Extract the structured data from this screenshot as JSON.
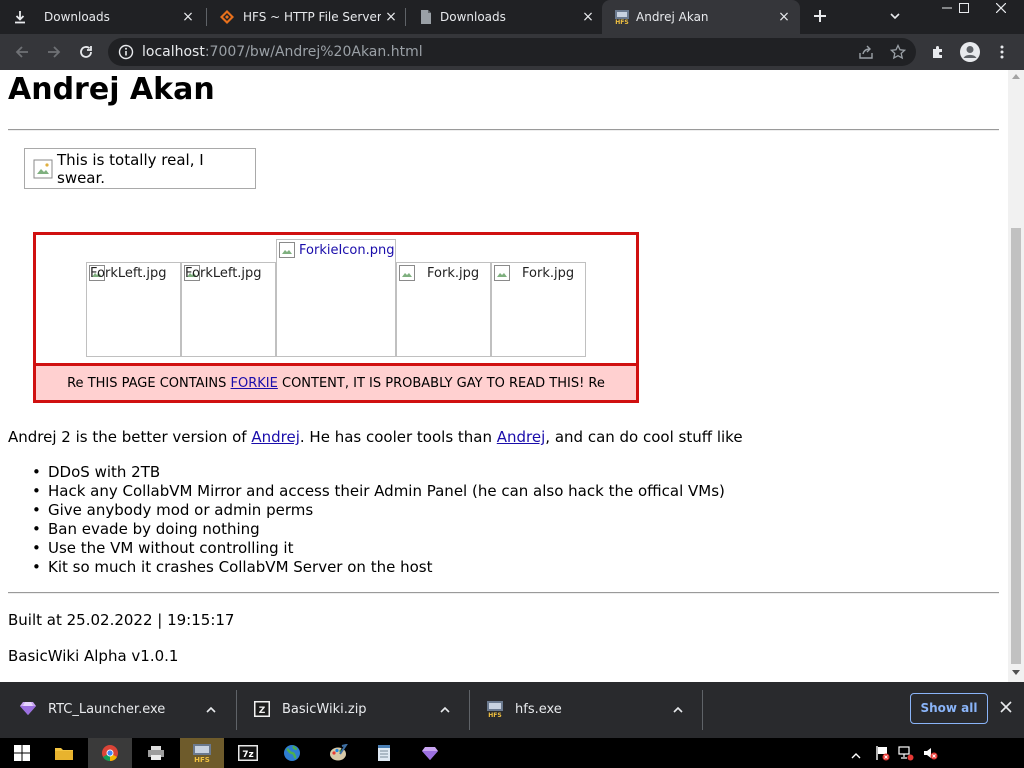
{
  "browser": {
    "tabs": [
      {
        "title": "Downloads",
        "icon": "download-icon",
        "active": false
      },
      {
        "title": "HFS ~ HTTP File Server d",
        "icon": "hfs-diamond-icon",
        "active": false
      },
      {
        "title": "Downloads",
        "icon": "page-icon",
        "active": false
      },
      {
        "title": "Andrej Akan",
        "icon": "hfs-logo-icon",
        "active": true
      }
    ],
    "new_tab_label": "+",
    "close_glyph": "×",
    "window_controls": {
      "minimize": "—",
      "maximize": "",
      "close": "✕"
    },
    "url_host": "localhost",
    "url_rest": ":7007/bw/Andrej%20Akan.html"
  },
  "page": {
    "title": "Andrej Akan",
    "caption": "This is totally real, I swear.",
    "forkie": {
      "images": [
        {
          "alt": "ForkLeft.jpg"
        },
        {
          "alt": "ForkLeft.jpg"
        },
        {
          "alt": "ForkieIcon.png",
          "link": true
        },
        {
          "alt": "Fork.jpg"
        },
        {
          "alt": "Fork.jpg"
        }
      ],
      "warning_before": "Re THIS PAGE CONTAINS ",
      "warning_link": "FORKIE",
      "warning_after": " CONTENT, IT IS PROBABLY GAY TO READ THIS! Re"
    },
    "intro": {
      "part1": "Andrej 2 is the better version of ",
      "link1": "Andrej",
      "part2": ". He has cooler tools than ",
      "link2": "Andrej",
      "part3": ", and can do cool stuff like"
    },
    "abilities": [
      "DDoS with 2TB",
      "Hack any CollabVM Mirror and access their Admin Panel (he can also hack the offical VMs)",
      "Give anybody mod or admin perms",
      "Ban evade by doing nothing",
      "Use the VM without controlling it",
      "Kit so much it crashes CollabVM Server on the host"
    ],
    "built_at": "Built at 25.02.2022 | 19:15:17",
    "version": "BasicWiki Alpha v1.0.1"
  },
  "downloads": {
    "items": [
      {
        "name": "RTC_Launcher.exe",
        "icon": "gem-icon"
      },
      {
        "name": "BasicWiki.zip",
        "icon": "zip-icon"
      },
      {
        "name": "hfs.exe",
        "icon": "hfs-logo-icon"
      }
    ],
    "show_all": "Show all"
  },
  "colors": {
    "accent_link": "#1a0dab",
    "forkie_border": "#d01010",
    "forkie_bg": "#ffd0d0",
    "chrome_dark": "#202124"
  }
}
